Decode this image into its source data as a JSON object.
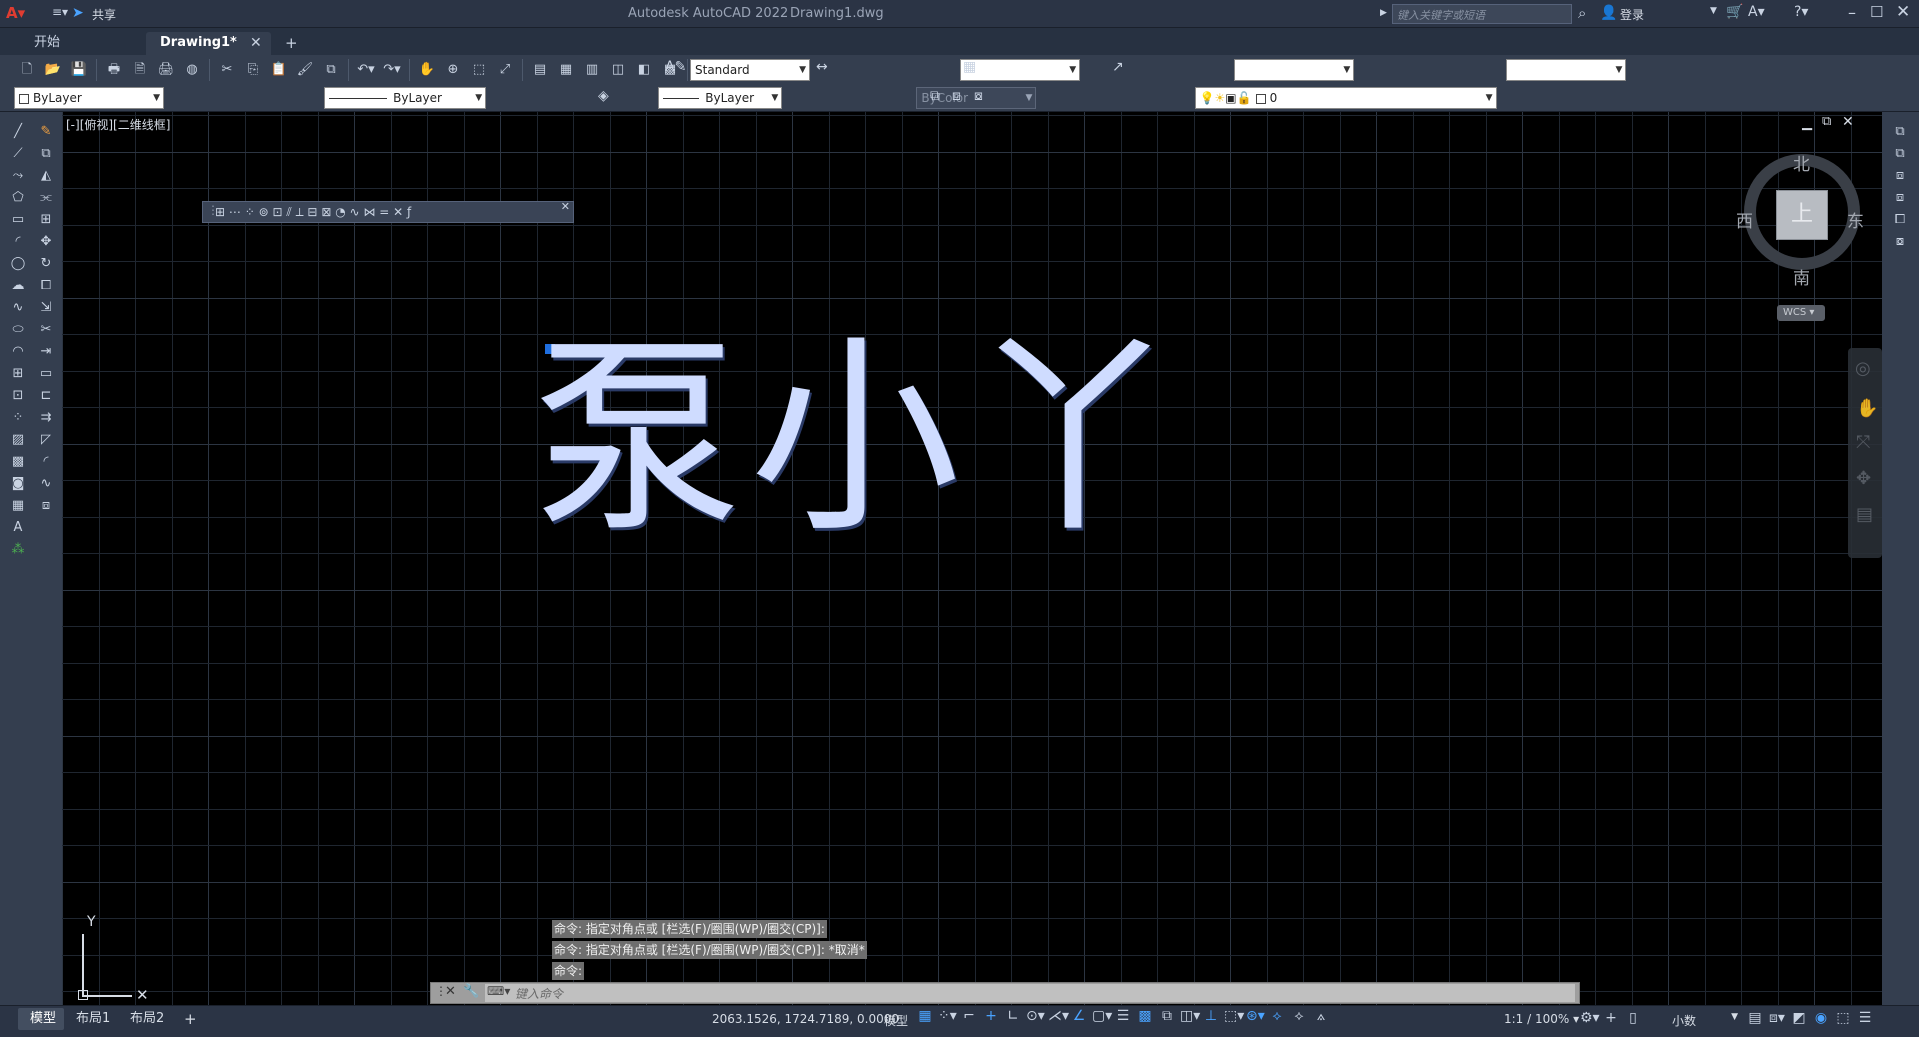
{
  "titlebar": {
    "app_title": "Autodesk AutoCAD 2022",
    "file_title": "Drawing1.dwg",
    "share_label": "共享",
    "search_placeholder": "键入关键字或短语",
    "login_label": "登录"
  },
  "tabs": [
    {
      "label": "开始"
    },
    {
      "label": "Drawing1*"
    }
  ],
  "toolbar": {
    "text_style": "Standard",
    "dim_style": "",
    "table_style": "",
    "mleader_style": ""
  },
  "properties": {
    "color": "ByLayer",
    "linetype": "ByLayer",
    "lineweight": "ByLayer",
    "plotstyle": "ByColor",
    "layer": "0"
  },
  "viewport": {
    "label": "[-][俯视][二维线框]",
    "drawing_text": "泵小丫",
    "ucs_y": "Y"
  },
  "viewcube": {
    "north": "北",
    "south": "南",
    "east": "东",
    "west": "西",
    "face": "上",
    "wcs": "WCS"
  },
  "command": {
    "history": [
      "命令: 指定对角点或 [栏选(F)/圈围(WP)/圈交(CP)]:",
      "命令: 指定对角点或 [栏选(F)/圈围(WP)/圈交(CP)]: *取消*",
      "命令:"
    ],
    "placeholder": "键入命令"
  },
  "layouts": [
    {
      "label": "模型"
    },
    {
      "label": "布局1"
    },
    {
      "label": "布局2"
    }
  ],
  "status": {
    "coords": "2063.1526, 1724.7189, 0.0000",
    "mode": "模型",
    "scale": "1:1 / 100%",
    "units": "小数"
  },
  "colors": {
    "titlebar": "#2b3445",
    "toolbar": "#343e4f",
    "canvas": "#000000",
    "text_fill": "#cfdcff",
    "grip": "#1f6fe0"
  }
}
